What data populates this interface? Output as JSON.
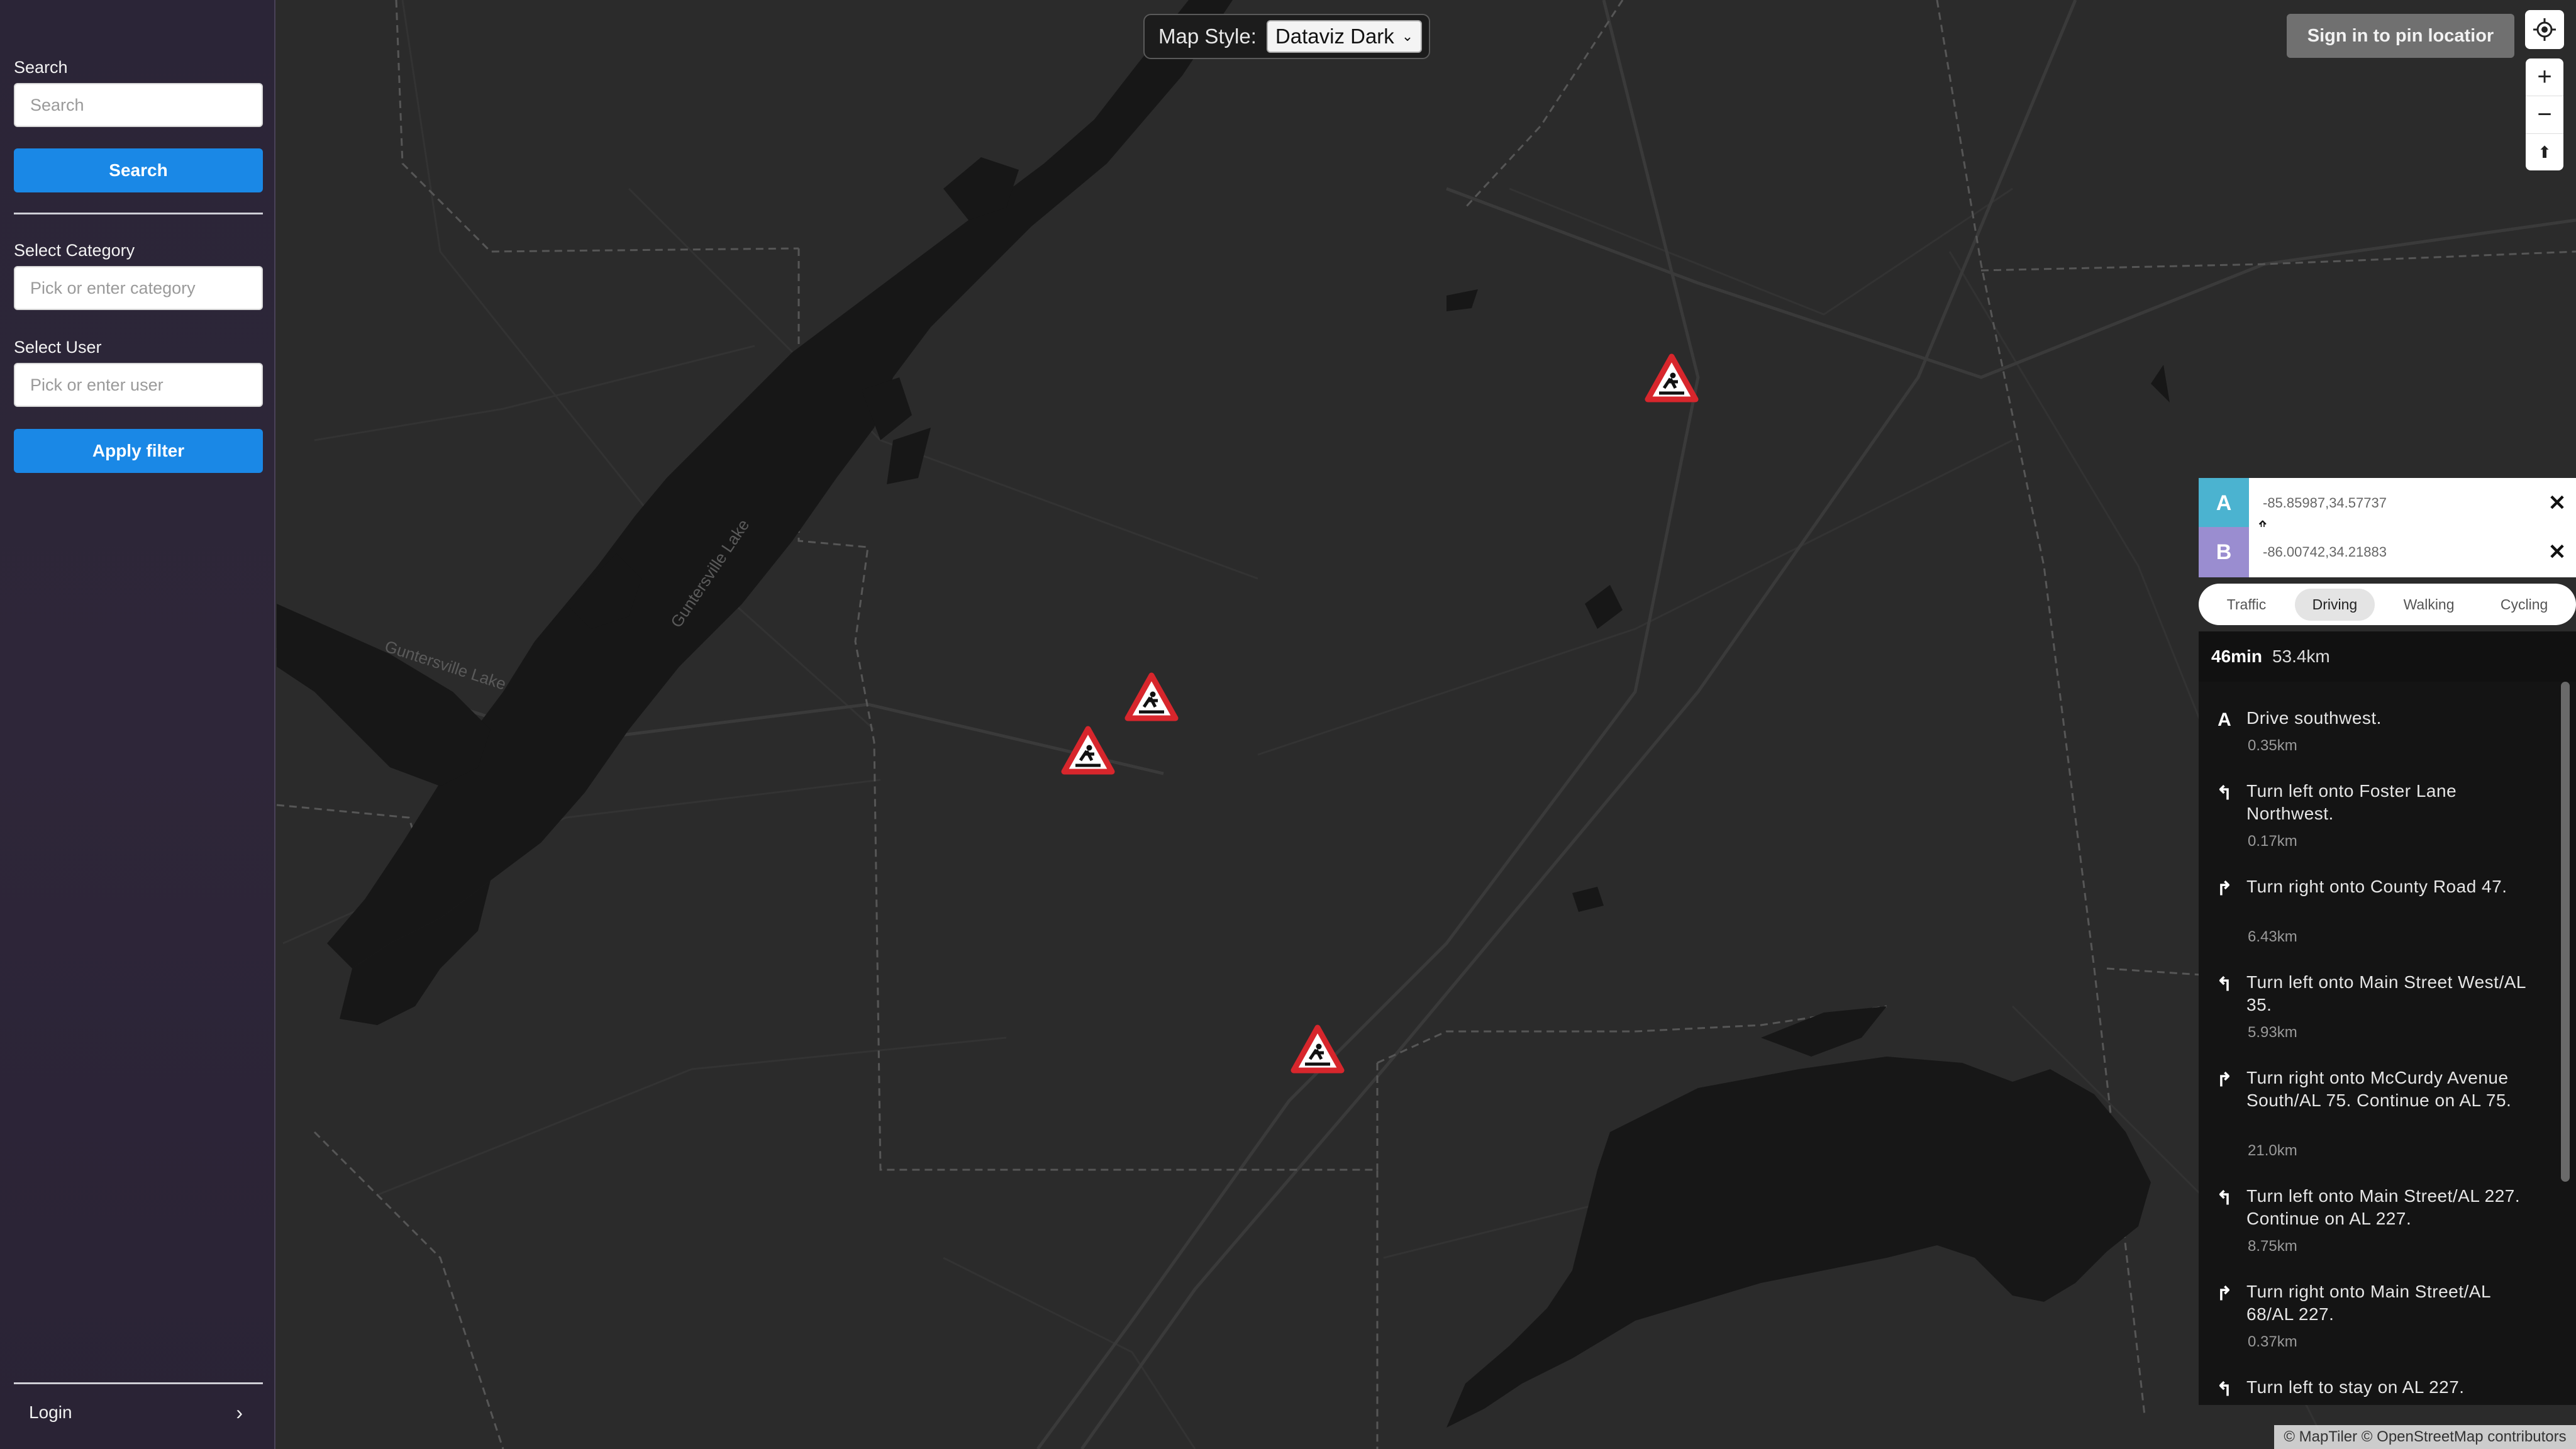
{
  "sidebar": {
    "search_label": "Search",
    "search_placeholder": "Search",
    "search_button": "Search",
    "category_label": "Select Category",
    "category_placeholder": "Pick or enter category",
    "user_label": "Select User",
    "user_placeholder": "Pick or enter user",
    "apply_button": "Apply filter",
    "login_label": "Login",
    "login_chevron": "›"
  },
  "map_style": {
    "label": "Map Style:",
    "selected": "Dataviz Dark",
    "chevron": "⌄"
  },
  "signin_button": "Sign in to pin locatior",
  "map_controls": {
    "zoom_in": "+",
    "zoom_out": "−",
    "compass": "⬆"
  },
  "map": {
    "lake_labels": [
      "Guntersville Lake",
      "Guntersville Lake"
    ],
    "markers": [
      "construction-warning-sign",
      "construction-warning-sign",
      "construction-warning-sign",
      "construction-warning-sign"
    ],
    "background_color": "#2b2b2b",
    "water_color": "#171717",
    "marker_color": "#d7262c"
  },
  "directions": {
    "origin": {
      "tag": "A",
      "value": "-85.85987,34.57737",
      "color": "#4bb3d0"
    },
    "destination": {
      "tag": "B",
      "value": "-86.00742,34.21883",
      "color": "#9a8dd0"
    },
    "swap_icon": "⇕",
    "clear_icon": "✕",
    "modes": [
      {
        "label": "Traffic",
        "active": false
      },
      {
        "label": "Driving",
        "active": true
      },
      {
        "label": "Walking",
        "active": false
      },
      {
        "label": "Cycling",
        "active": false
      }
    ],
    "summary": {
      "time": "46min",
      "distance": "53.4km"
    },
    "steps": [
      {
        "icon": "A",
        "text": "Drive southwest.",
        "distance": "0.35km"
      },
      {
        "icon": "↰",
        "text": "Turn left onto Foster Lane Northwest.",
        "distance": "0.17km"
      },
      {
        "icon": "↱",
        "text": "Turn right onto County Road 47.",
        "distance": "6.43km"
      },
      {
        "icon": "↰",
        "text": "Turn left onto Main Street West/AL 35.",
        "distance": "5.93km"
      },
      {
        "icon": "↱",
        "text": "Turn right onto McCurdy Avenue South/AL 75. Continue on AL 75.",
        "distance": "21.0km"
      },
      {
        "icon": "↰",
        "text": "Turn left onto Main Street/AL 227. Continue on AL 227.",
        "distance": "8.75km"
      },
      {
        "icon": "↱",
        "text": "Turn right onto Main Street/AL 68/AL 227.",
        "distance": "0.37km"
      },
      {
        "icon": "↰",
        "text": "Turn left to stay on AL 227.",
        "distance": ""
      }
    ]
  },
  "attribution": "© MapTiler © OpenStreetMap contributors"
}
